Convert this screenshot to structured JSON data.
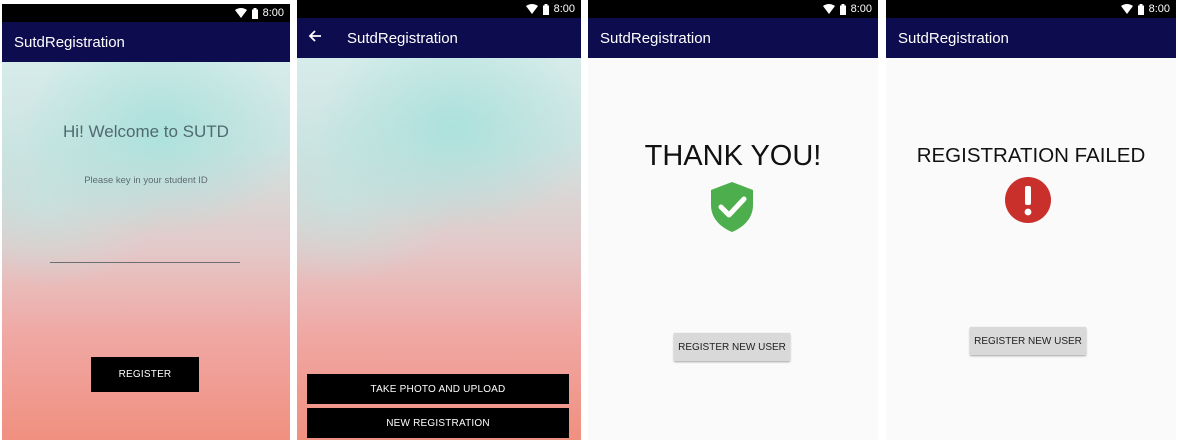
{
  "status_bar": {
    "time": "8:00"
  },
  "colors": {
    "app_bar": "#0c0c4e",
    "success_green": "#4cae4c",
    "error_red": "#c9302c",
    "dark_button": "#000000",
    "grey_button": "#d9d9d9"
  },
  "screen_login": {
    "title": "SutdRegistration",
    "welcome": "Hi! Welcome to SUTD",
    "hint": "Please key in your student ID",
    "student_id_value": "",
    "register_label": "REGISTER"
  },
  "screen_actions": {
    "title": "SutdRegistration",
    "back_icon": "arrow-back-icon",
    "take_photo_label": "TAKE PHOTO AND UPLOAD",
    "new_registration_label": "NEW REGISTRATION"
  },
  "screen_success": {
    "title": "SutdRegistration",
    "heading": "THANK YOU!",
    "icon": "shield-check-icon",
    "button_label": "REGISTER NEW USER"
  },
  "screen_failed": {
    "title": "SutdRegistration",
    "heading": "REGISTRATION FAILED",
    "icon": "error-circle-icon",
    "button_label": "REGISTER NEW USER"
  }
}
